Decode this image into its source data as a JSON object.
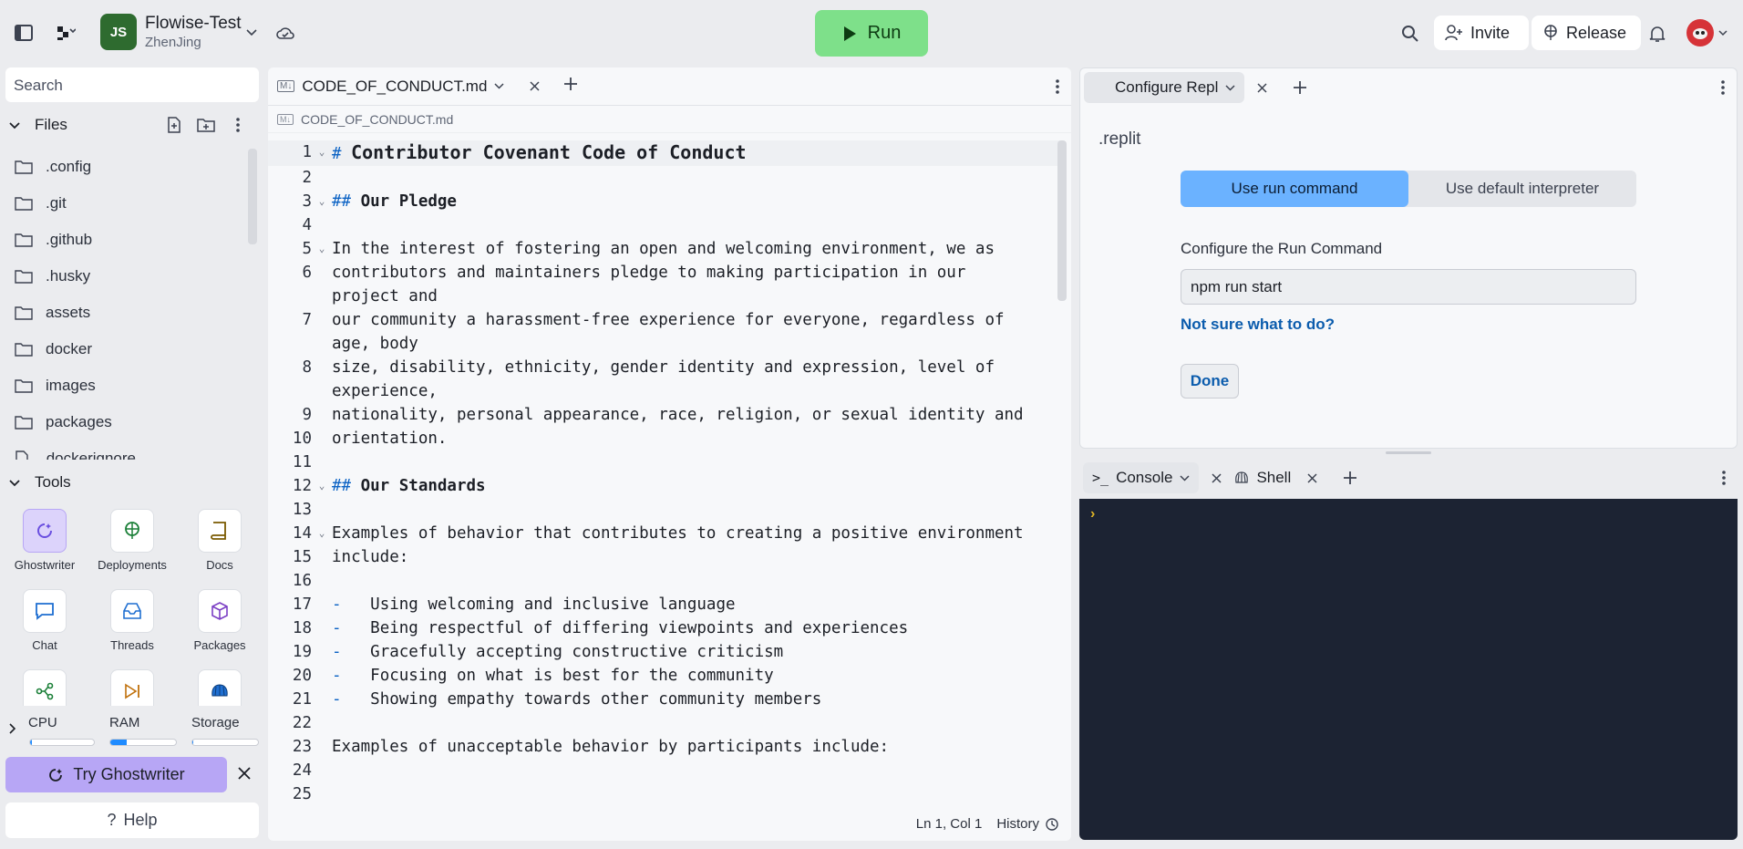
{
  "header": {
    "project_name": "Flowise-Test",
    "project_owner": "ZhenJing",
    "logo_text": "JS",
    "run_label": "Run",
    "invite_label": "Invite",
    "release_label": "Release"
  },
  "sidebar": {
    "search_placeholder": "Search",
    "files_title": "Files",
    "files": [
      ".config",
      ".git",
      ".github",
      ".husky",
      "assets",
      "docker",
      "images",
      "packages",
      ".dockerignore"
    ],
    "tools_title": "Tools",
    "tools": [
      "Ghostwriter",
      "Deployments",
      "Docs",
      "Chat",
      "Threads",
      "Packages"
    ],
    "metrics": {
      "cpu_label": "CPU",
      "ram_label": "RAM",
      "storage_label": "Storage",
      "cpu_level": 0.03,
      "ram_level": 0.25,
      "storage_level": 0.02
    },
    "try_ghostwriter": "Try Ghostwriter",
    "help": "Help"
  },
  "editor": {
    "tab_label": "CODE_OF_CONDUCT.md",
    "breadcrumb": "CODE_OF_CONDUCT.md",
    "lines": [
      {
        "n": "1",
        "t": "# Contributor Covenant Code of Conduct",
        "kind": "h1",
        "fold": true
      },
      {
        "n": "2",
        "t": ""
      },
      {
        "n": "3",
        "t": "## Our Pledge",
        "kind": "h2",
        "fold": true
      },
      {
        "n": "4",
        "t": ""
      },
      {
        "n": "5",
        "t": "In the interest of fostering an open and welcoming environment, we as",
        "fold": true
      },
      {
        "n": "6",
        "t": "contributors and maintainers pledge to making participation in our project and"
      },
      {
        "n": "7",
        "t": "our community a harassment-free experience for everyone, regardless of age, body"
      },
      {
        "n": "8",
        "t": "size, disability, ethnicity, gender identity and expression, level of experience,"
      },
      {
        "n": "9",
        "t": "nationality, personal appearance, race, religion, or sexual identity and"
      },
      {
        "n": "10",
        "t": "orientation."
      },
      {
        "n": "11",
        "t": ""
      },
      {
        "n": "12",
        "t": "## Our Standards",
        "kind": "h2",
        "fold": true
      },
      {
        "n": "13",
        "t": ""
      },
      {
        "n": "14",
        "t": "Examples of behavior that contributes to creating a positive environment",
        "fold": true
      },
      {
        "n": "15",
        "t": "include:"
      },
      {
        "n": "16",
        "t": ""
      },
      {
        "n": "17",
        "t": "Using welcoming and inclusive language",
        "kind": "li"
      },
      {
        "n": "18",
        "t": "Being respectful of differing viewpoints and experiences",
        "kind": "li"
      },
      {
        "n": "19",
        "t": "Gracefully accepting constructive criticism",
        "kind": "li"
      },
      {
        "n": "20",
        "t": "Focusing on what is best for the community",
        "kind": "li"
      },
      {
        "n": "21",
        "t": "Showing empathy towards other community members",
        "kind": "li"
      },
      {
        "n": "22",
        "t": ""
      },
      {
        "n": "23",
        "t": "Examples of unacceptable behavior by participants include:"
      },
      {
        "n": "24",
        "t": ""
      },
      {
        "n": "25",
        "t": ""
      }
    ],
    "cursor_pos": "Ln 1, Col 1",
    "history_label": "History"
  },
  "config": {
    "tab_label": "Configure Repl",
    "title": ".replit",
    "seg_run": "Use run command",
    "seg_default": "Use default interpreter",
    "run_cmd_label": "Configure the Run Command",
    "run_cmd_value": "npm run start",
    "help_link": "Not sure what to do?",
    "done_label": "Done"
  },
  "console": {
    "console_tab": "Console",
    "shell_tab": "Shell",
    "prompt": "›"
  },
  "colors": {
    "accent": "#7ee08a",
    "ghostwriter": "#b7a6f5",
    "link": "#0b5cad",
    "console_bg": "#1c2333"
  }
}
